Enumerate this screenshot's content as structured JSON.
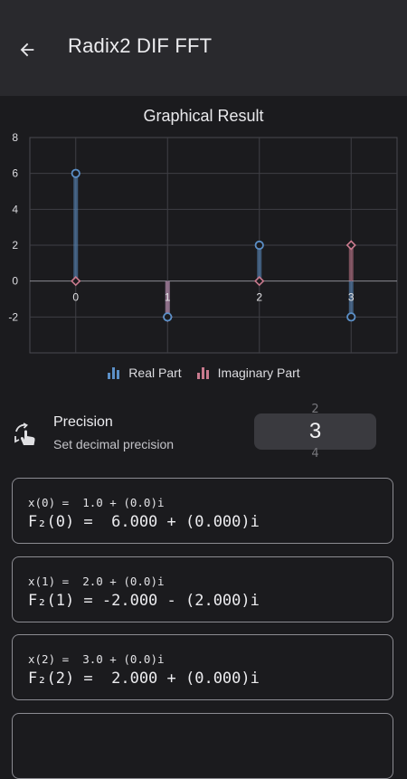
{
  "appbar": {
    "title": "Radix2 DIF FFT"
  },
  "chart_data": {
    "type": "bar",
    "title": "Graphical Result",
    "xlabel": "",
    "ylabel": "",
    "categories": [
      "0",
      "1",
      "2",
      "3"
    ],
    "series": [
      {
        "name": "Real Part",
        "values": [
          6,
          -2,
          2,
          -2
        ],
        "color": "#5b8fc7"
      },
      {
        "name": "Imaginary Part",
        "values": [
          0,
          -2,
          0,
          2
        ],
        "color": "#c97a8e"
      }
    ],
    "ylim": [
      -4,
      8
    ],
    "yticks": [
      8,
      6,
      4,
      2,
      0,
      -2
    ],
    "grid": true,
    "legend": "bottom"
  },
  "precision": {
    "title": "Precision",
    "subtitle": "Set decimal precision",
    "prev": "2",
    "value": "3",
    "next": "4",
    "icon": "swipe-gesture-icon"
  },
  "results": [
    {
      "input": "x(0) =  1.0 + (0.0)i",
      "output": "F₂(0) =  6.000 + (0.000)i"
    },
    {
      "input": "x(1) =  2.0 + (0.0)i",
      "output": "F₂(1) = -2.000 - (2.000)i"
    },
    {
      "input": "x(2) =  3.0 + (0.0)i",
      "output": "F₂(2) =  2.000 + (0.000)i"
    }
  ]
}
